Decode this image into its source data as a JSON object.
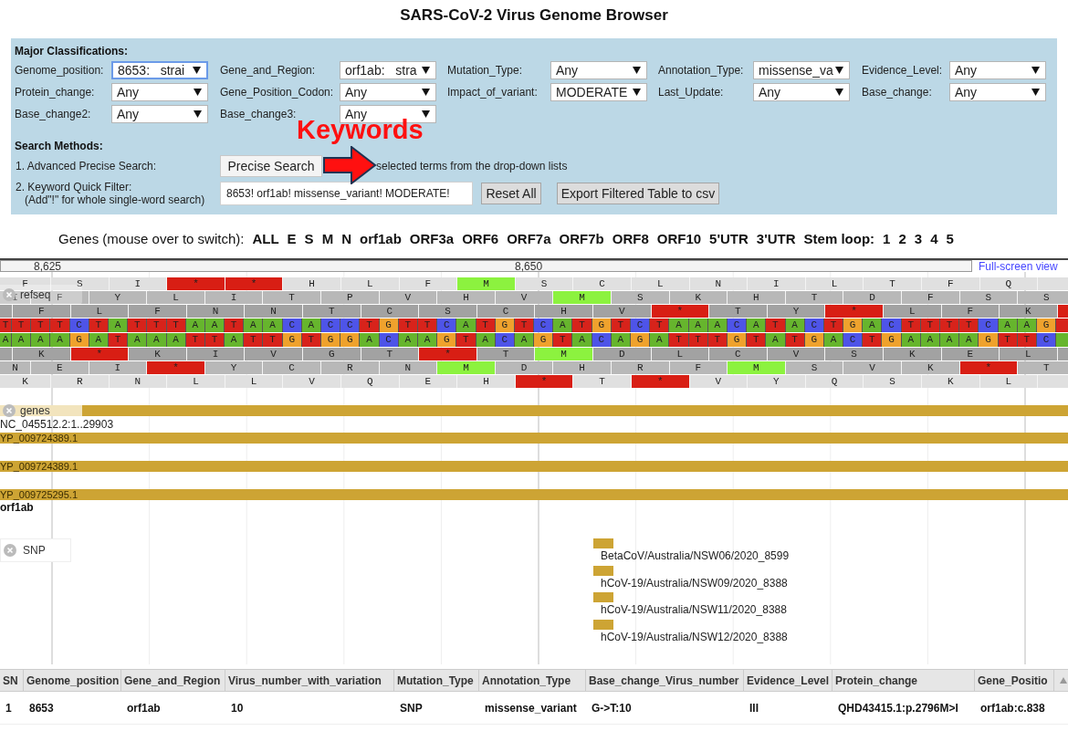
{
  "page_title": "SARS-CoV-2 Virus Genome Browser",
  "filters": {
    "heading": "Major Classifications:",
    "fields": [
      {
        "label": "Genome_position:",
        "value": "8653:   strai",
        "focused": true
      },
      {
        "label": "Gene_and_Region:",
        "value": "orf1ab:   stra",
        "focused": false
      },
      {
        "label": "Mutation_Type:",
        "value": "Any",
        "focused": false
      },
      {
        "label": "Annotation_Type:",
        "value": "missense_va",
        "focused": false
      },
      {
        "label": "Evidence_Level:",
        "value": "Any",
        "focused": false
      },
      {
        "label": "Protein_change:",
        "value": "Any",
        "focused": false
      },
      {
        "label": "Gene_Position_Codon:",
        "value": "Any",
        "focused": false
      },
      {
        "label": "Impact_of_variant:",
        "value": "MODERATE",
        "focused": false
      },
      {
        "label": "Last_Update:",
        "value": "Any",
        "focused": false
      },
      {
        "label": "Base_change:",
        "value": "Any",
        "focused": false
      },
      {
        "label": "Base_change2:",
        "value": "Any",
        "focused": false
      },
      {
        "label": "Base_change3:",
        "value": "Any",
        "focused": false
      }
    ]
  },
  "search_methods": {
    "heading": "Search Methods:",
    "precise": {
      "label": "1. Advanced Precise Search:",
      "button": "Precise Search",
      "hint": "selected terms from the drop-down lists"
    },
    "quick": {
      "label": "2. Keyword Quick Filter:",
      "sublabel": "(Add\"!\" for whole single-word search)",
      "value": "8653! orf1ab! missense_variant! MODERATE!",
      "reset": "Reset All",
      "export": "Export Filtered Table to csv"
    }
  },
  "annotation": {
    "text": "Keywords"
  },
  "genes_nav": {
    "label": "Genes (mouse over to switch):",
    "genes": [
      "ALL",
      "E",
      "S",
      "M",
      "N",
      "orf1ab",
      "ORF3a",
      "ORF6",
      "ORF7a",
      "ORF7b",
      "ORF8",
      "ORF10",
      "5'UTR",
      "3'UTR"
    ],
    "stem_loop": {
      "label": "Stem loop:",
      "items": [
        "1",
        "2",
        "3",
        "4",
        "5"
      ]
    }
  },
  "ruler": {
    "ticks": [
      "8,625",
      "8,650"
    ],
    "link": "Full-screen view"
  },
  "refseq": {
    "label": "refseq",
    "forward_frames": [
      [
        {
          "aa": "F",
          "kind": "plain"
        },
        {
          "aa": "S",
          "kind": "plain"
        },
        {
          "aa": "I",
          "kind": "plain"
        },
        {
          "aa": "*",
          "kind": "stop"
        },
        {
          "aa": "*",
          "kind": "stop"
        },
        {
          "aa": "H",
          "kind": "plain"
        },
        {
          "aa": "L",
          "kind": "plain"
        },
        {
          "aa": "F",
          "kind": "plain"
        },
        {
          "aa": "M",
          "kind": "start"
        },
        {
          "aa": "S",
          "kind": "plain"
        },
        {
          "aa": "C",
          "kind": "plain"
        },
        {
          "aa": "L",
          "kind": "plain"
        },
        {
          "aa": "N",
          "kind": "plain"
        },
        {
          "aa": "I",
          "kind": "plain"
        },
        {
          "aa": "L",
          "kind": "plain"
        },
        {
          "aa": "T",
          "kind": "plain"
        },
        {
          "aa": "F",
          "kind": "plain"
        },
        {
          "aa": "Q",
          "kind": "plain"
        },
        {
          "kind": "plain"
        }
      ],
      [
        {
          "aa": "I",
          "kind": "plain"
        },
        {
          "aa": "F",
          "kind": "plain"
        },
        {
          "aa": "Y",
          "kind": "plain"
        },
        {
          "aa": "L",
          "kind": "plain"
        },
        {
          "aa": "I",
          "kind": "plain"
        },
        {
          "aa": "T",
          "kind": "plain"
        },
        {
          "aa": "P",
          "kind": "plain"
        },
        {
          "aa": "V",
          "kind": "plain"
        },
        {
          "aa": "H",
          "kind": "plain"
        },
        {
          "aa": "V",
          "kind": "plain"
        },
        {
          "aa": "M",
          "kind": "start"
        },
        {
          "aa": "S",
          "kind": "plain"
        },
        {
          "aa": "K",
          "kind": "plain"
        },
        {
          "aa": "H",
          "kind": "plain"
        },
        {
          "aa": "T",
          "kind": "plain"
        },
        {
          "aa": "D",
          "kind": "plain"
        },
        {
          "aa": "F",
          "kind": "plain"
        },
        {
          "aa": "S",
          "kind": "plain"
        },
        {
          "aa": "S",
          "kind": "plain"
        }
      ],
      [
        {
          "kind": "plain"
        },
        {
          "aa": "F",
          "kind": "plain"
        },
        {
          "aa": "L",
          "kind": "plain"
        },
        {
          "aa": "F",
          "kind": "plain"
        },
        {
          "aa": "N",
          "kind": "plain"
        },
        {
          "aa": "N",
          "kind": "plain"
        },
        {
          "aa": "T",
          "kind": "plain"
        },
        {
          "aa": "C",
          "kind": "plain"
        },
        {
          "aa": "S",
          "kind": "plain"
        },
        {
          "aa": "C",
          "kind": "plain"
        },
        {
          "aa": "H",
          "kind": "plain"
        },
        {
          "aa": "V",
          "kind": "plain"
        },
        {
          "aa": "*",
          "kind": "stop"
        },
        {
          "aa": "T",
          "kind": "plain"
        },
        {
          "aa": "Y",
          "kind": "plain"
        },
        {
          "aa": "*",
          "kind": "stop"
        },
        {
          "aa": "L",
          "kind": "plain"
        },
        {
          "aa": "F",
          "kind": "plain"
        },
        {
          "aa": "K",
          "kind": "plain"
        },
        {
          "kind": "stop"
        }
      ]
    ],
    "forward_strand": [
      {
        "base": "T",
        "color": "#d7231b"
      },
      {
        "base": "T",
        "color": "#d7231b"
      },
      {
        "base": "T",
        "color": "#d7231b"
      },
      {
        "base": "T",
        "color": "#d7231b"
      },
      {
        "base": "C",
        "color": "#4e54e8"
      },
      {
        "base": "T",
        "color": "#d7231b"
      },
      {
        "base": "A",
        "color": "#66b52d"
      },
      {
        "base": "T",
        "color": "#d7231b"
      },
      {
        "base": "T",
        "color": "#d7231b"
      },
      {
        "base": "T",
        "color": "#d7231b"
      },
      {
        "base": "A",
        "color": "#66b52d"
      },
      {
        "base": "A",
        "color": "#66b52d"
      },
      {
        "base": "T",
        "color": "#d7231b"
      },
      {
        "base": "A",
        "color": "#66b52d"
      },
      {
        "base": "A",
        "color": "#66b52d"
      },
      {
        "base": "C",
        "color": "#4e54e8"
      },
      {
        "base": "A",
        "color": "#66b52d"
      },
      {
        "base": "C",
        "color": "#4e54e8"
      },
      {
        "base": "C",
        "color": "#4e54e8"
      },
      {
        "base": "T",
        "color": "#d7231b"
      },
      {
        "base": "G",
        "color": "#efa22d"
      },
      {
        "base": "T",
        "color": "#d7231b"
      },
      {
        "base": "T",
        "color": "#d7231b"
      },
      {
        "base": "C",
        "color": "#4e54e8"
      },
      {
        "base": "A",
        "color": "#66b52d"
      },
      {
        "base": "T",
        "color": "#d7231b"
      },
      {
        "base": "G",
        "color": "#efa22d"
      },
      {
        "base": "T",
        "color": "#d7231b"
      },
      {
        "base": "C",
        "color": "#4e54e8"
      },
      {
        "base": "A",
        "color": "#66b52d"
      },
      {
        "base": "T",
        "color": "#d7231b"
      },
      {
        "base": "G",
        "color": "#efa22d"
      },
      {
        "base": "T",
        "color": "#d7231b"
      },
      {
        "base": "C",
        "color": "#4e54e8"
      },
      {
        "base": "T",
        "color": "#d7231b"
      },
      {
        "base": "A",
        "color": "#66b52d"
      },
      {
        "base": "A",
        "color": "#66b52d"
      },
      {
        "base": "A",
        "color": "#66b52d"
      },
      {
        "base": "C",
        "color": "#4e54e8"
      },
      {
        "base": "A",
        "color": "#66b52d"
      },
      {
        "base": "T",
        "color": "#d7231b"
      },
      {
        "base": "A",
        "color": "#66b52d"
      },
      {
        "base": "C",
        "color": "#4e54e8"
      },
      {
        "base": "T",
        "color": "#d7231b"
      },
      {
        "base": "G",
        "color": "#efa22d"
      },
      {
        "base": "A",
        "color": "#66b52d"
      },
      {
        "base": "C",
        "color": "#4e54e8"
      },
      {
        "base": "T",
        "color": "#d7231b"
      },
      {
        "base": "T",
        "color": "#d7231b"
      },
      {
        "base": "T",
        "color": "#d7231b"
      },
      {
        "base": "T",
        "color": "#d7231b"
      },
      {
        "base": "C",
        "color": "#4e54e8"
      },
      {
        "base": "A",
        "color": "#66b52d"
      },
      {
        "base": "A",
        "color": "#66b52d"
      },
      {
        "base": "G",
        "color": "#efa22d"
      },
      {
        "color": "#d7231b"
      }
    ],
    "reverse_strand": [
      {
        "base": "A",
        "color": "#66b52d"
      },
      {
        "base": "A",
        "color": "#66b52d"
      },
      {
        "base": "A",
        "color": "#66b52d"
      },
      {
        "base": "A",
        "color": "#66b52d"
      },
      {
        "base": "G",
        "color": "#efa22d"
      },
      {
        "base": "A",
        "color": "#66b52d"
      },
      {
        "base": "T",
        "color": "#d7231b"
      },
      {
        "base": "A",
        "color": "#66b52d"
      },
      {
        "base": "A",
        "color": "#66b52d"
      },
      {
        "base": "A",
        "color": "#66b52d"
      },
      {
        "base": "T",
        "color": "#d7231b"
      },
      {
        "base": "T",
        "color": "#d7231b"
      },
      {
        "base": "A",
        "color": "#66b52d"
      },
      {
        "base": "T",
        "color": "#d7231b"
      },
      {
        "base": "T",
        "color": "#d7231b"
      },
      {
        "base": "G",
        "color": "#efa22d"
      },
      {
        "base": "T",
        "color": "#d7231b"
      },
      {
        "base": "G",
        "color": "#efa22d"
      },
      {
        "base": "G",
        "color": "#efa22d"
      },
      {
        "base": "A",
        "color": "#66b52d"
      },
      {
        "base": "C",
        "color": "#4e54e8"
      },
      {
        "base": "A",
        "color": "#66b52d"
      },
      {
        "base": "A",
        "color": "#66b52d"
      },
      {
        "base": "G",
        "color": "#efa22d"
      },
      {
        "base": "T",
        "color": "#d7231b"
      },
      {
        "base": "A",
        "color": "#66b52d"
      },
      {
        "base": "C",
        "color": "#4e54e8"
      },
      {
        "base": "A",
        "color": "#66b52d"
      },
      {
        "base": "G",
        "color": "#efa22d"
      },
      {
        "base": "T",
        "color": "#d7231b"
      },
      {
        "base": "A",
        "color": "#66b52d"
      },
      {
        "base": "C",
        "color": "#4e54e8"
      },
      {
        "base": "A",
        "color": "#66b52d"
      },
      {
        "base": "G",
        "color": "#efa22d"
      },
      {
        "base": "A",
        "color": "#66b52d"
      },
      {
        "base": "T",
        "color": "#d7231b"
      },
      {
        "base": "T",
        "color": "#d7231b"
      },
      {
        "base": "T",
        "color": "#d7231b"
      },
      {
        "base": "G",
        "color": "#efa22d"
      },
      {
        "base": "T",
        "color": "#d7231b"
      },
      {
        "base": "A",
        "color": "#66b52d"
      },
      {
        "base": "T",
        "color": "#d7231b"
      },
      {
        "base": "G",
        "color": "#efa22d"
      },
      {
        "base": "A",
        "color": "#66b52d"
      },
      {
        "base": "C",
        "color": "#4e54e8"
      },
      {
        "base": "T",
        "color": "#d7231b"
      },
      {
        "base": "G",
        "color": "#efa22d"
      },
      {
        "base": "A",
        "color": "#66b52d"
      },
      {
        "base": "A",
        "color": "#66b52d"
      },
      {
        "base": "A",
        "color": "#66b52d"
      },
      {
        "base": "A",
        "color": "#66b52d"
      },
      {
        "base": "G",
        "color": "#efa22d"
      },
      {
        "base": "T",
        "color": "#d7231b"
      },
      {
        "base": "T",
        "color": "#d7231b"
      },
      {
        "base": "C",
        "color": "#4e54e8"
      },
      {
        "color": "#66b52d"
      }
    ],
    "reverse_frames": [
      [
        {
          "kind": "plain"
        },
        {
          "aa": "K",
          "kind": "plain"
        },
        {
          "aa": "*",
          "kind": "stop"
        },
        {
          "aa": "K",
          "kind": "plain"
        },
        {
          "aa": "I",
          "kind": "plain"
        },
        {
          "aa": "V",
          "kind": "plain"
        },
        {
          "aa": "G",
          "kind": "plain"
        },
        {
          "aa": "T",
          "kind": "plain"
        },
        {
          "aa": "*",
          "kind": "stop"
        },
        {
          "aa": "T",
          "kind": "plain"
        },
        {
          "aa": "M",
          "kind": "start"
        },
        {
          "aa": "D",
          "kind": "plain"
        },
        {
          "aa": "L",
          "kind": "plain"
        },
        {
          "aa": "C",
          "kind": "plain"
        },
        {
          "aa": "V",
          "kind": "plain"
        },
        {
          "aa": "S",
          "kind": "plain"
        },
        {
          "aa": "K",
          "kind": "plain"
        },
        {
          "aa": "E",
          "kind": "plain"
        },
        {
          "aa": "L",
          "kind": "plain"
        },
        {
          "kind": "plain"
        }
      ],
      [
        {
          "aa": "N",
          "kind": "plain"
        },
        {
          "aa": "E",
          "kind": "plain"
        },
        {
          "aa": "I",
          "kind": "plain"
        },
        {
          "aa": "*",
          "kind": "stop"
        },
        {
          "aa": "Y",
          "kind": "plain"
        },
        {
          "aa": "C",
          "kind": "plain"
        },
        {
          "aa": "R",
          "kind": "plain"
        },
        {
          "aa": "N",
          "kind": "plain"
        },
        {
          "aa": "M",
          "kind": "start"
        },
        {
          "aa": "D",
          "kind": "plain"
        },
        {
          "aa": "H",
          "kind": "plain"
        },
        {
          "aa": "R",
          "kind": "plain"
        },
        {
          "aa": "F",
          "kind": "plain"
        },
        {
          "aa": "M",
          "kind": "start"
        },
        {
          "aa": "S",
          "kind": "plain"
        },
        {
          "aa": "V",
          "kind": "plain"
        },
        {
          "aa": "K",
          "kind": "plain"
        },
        {
          "aa": "*",
          "kind": "stop"
        },
        {
          "aa": "T",
          "kind": "plain"
        }
      ],
      [
        {
          "aa": "K",
          "kind": "plain"
        },
        {
          "aa": "R",
          "kind": "plain"
        },
        {
          "aa": "N",
          "kind": "plain"
        },
        {
          "aa": "L",
          "kind": "plain"
        },
        {
          "aa": "L",
          "kind": "plain"
        },
        {
          "aa": "V",
          "kind": "plain"
        },
        {
          "aa": "Q",
          "kind": "plain"
        },
        {
          "aa": "E",
          "kind": "plain"
        },
        {
          "aa": "H",
          "kind": "plain"
        },
        {
          "aa": "*",
          "kind": "stop"
        },
        {
          "aa": "T",
          "kind": "plain"
        },
        {
          "aa": "*",
          "kind": "stop"
        },
        {
          "aa": "V",
          "kind": "plain"
        },
        {
          "aa": "Y",
          "kind": "plain"
        },
        {
          "aa": "Q",
          "kind": "plain"
        },
        {
          "aa": "S",
          "kind": "plain"
        },
        {
          "aa": "K",
          "kind": "plain"
        },
        {
          "aa": "L",
          "kind": "plain"
        },
        {
          "kind": "plain"
        }
      ]
    ]
  },
  "genes_track": {
    "label": "genes",
    "region": "NC_045512.2:1..29903",
    "features": [
      "YP_009724389.1",
      "YP_009724389.1",
      "YP_009725295.1"
    ],
    "gene_name": "orf1ab"
  },
  "snp_track": {
    "label": "SNP",
    "features": [
      "BetaCoV/Australia/NSW06/2020_8599",
      "hCoV-19/Australia/NSW09/2020_8388",
      "hCoV-19/Australia/NSW11/2020_8388",
      "hCoV-19/Australia/NSW12/2020_8388"
    ]
  },
  "table": {
    "columns": [
      "SN",
      "Genome_position",
      "Gene_and_Region",
      "Virus_number_with_variation",
      "Mutation_Type",
      "Annotation_Type",
      "Base_change_Virus_number",
      "Evidence_Level",
      "Protein_change",
      "Gene_Positio"
    ],
    "rows": [
      [
        "1",
        "8653",
        "orf1ab",
        "10",
        "SNP",
        "missense_variant",
        "G->T:10",
        "III",
        "QHD43415.1:p.2796M>I",
        "orf1ab:c.838"
      ]
    ]
  }
}
